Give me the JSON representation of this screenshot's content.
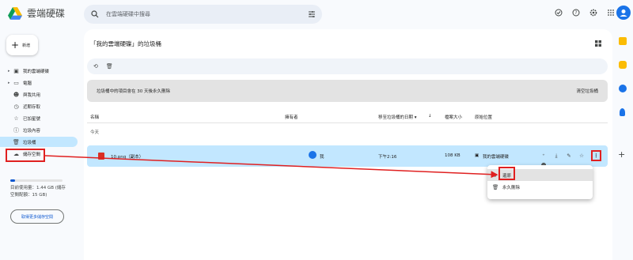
{
  "app": {
    "title": "雲端硬碟"
  },
  "search": {
    "placeholder": "在雲端硬碟中搜尋"
  },
  "top_icons": [
    "offline-icon",
    "help-icon",
    "settings-icon",
    "apps-icon"
  ],
  "sidebar": {
    "new_label": "新增",
    "items": [
      {
        "label": "我的雲端硬碟",
        "icon": "drive-icon",
        "caret": true
      },
      {
        "label": "電腦",
        "icon": "computer-icon",
        "caret": true
      },
      {
        "label": "與我共用",
        "icon": "shared-icon",
        "caret": false
      },
      {
        "label": "近期存取",
        "icon": "recent-icon",
        "caret": false
      },
      {
        "label": "已加星號",
        "icon": "star-icon",
        "caret": false
      },
      {
        "label": "垃圾內容",
        "icon": "spam-icon",
        "caret": false
      },
      {
        "label": "垃圾桶",
        "icon": "trash-icon",
        "caret": false,
        "active": true
      },
      {
        "label": "儲存空間",
        "icon": "cloud-icon",
        "caret": false
      }
    ],
    "storage_text": "目前使用量：1.44 GB (儲存空間配額：15 GB)",
    "storage_fraction": 0.096,
    "more_storage_label": "取得更多儲存空間"
  },
  "main": {
    "title": "「我的雲端硬碟」的垃圾桶",
    "notice": "垃圾桶中的項目會在 30 天後永久刪除",
    "empty_trash": "清空垃圾桶",
    "columns": {
      "name": "名稱",
      "owner": "擁有者",
      "date_trashed": "移至垃圾桶的日期 ▾",
      "sort_arrow": "↓",
      "size": "檔案大小",
      "location": "原始位置"
    },
    "section": "今天",
    "rows": [
      {
        "name": "10.png（副本）",
        "owner": "我",
        "date": "下午2:16",
        "size": "108 KB",
        "location": "我的雲端硬碟"
      }
    ]
  },
  "context_menu": {
    "restore": "還原",
    "delete_forever": "永久刪除"
  },
  "colors": {
    "accent": "#0b57d0",
    "selected": "#c2e7ff",
    "annotation": "#e02020"
  }
}
